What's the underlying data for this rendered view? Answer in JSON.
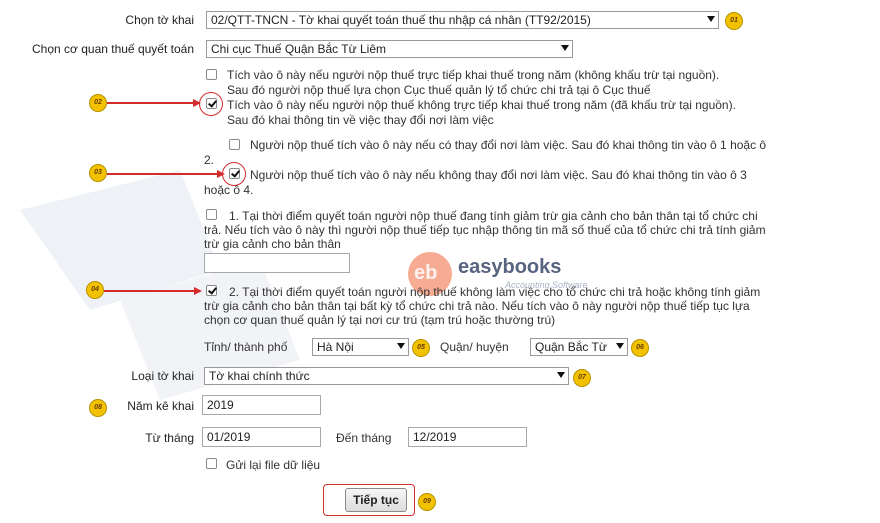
{
  "form": {
    "to_khai_label": "Chọn tờ khai",
    "to_khai_value": "02/QTT-TNCN - Tờ khai quyết toán thuế thu nhập cá nhân (TT92/2015)",
    "co_quan_label": "Chọn cơ quan thuế quyết toán",
    "co_quan_value": "Chi cục Thuế Quận Bắc Từ Liêm",
    "opt1_line1": "Tích vào ô này nếu người nộp thuế trực tiếp khai thuế trong năm (không khấu trừ tại nguồn).",
    "opt1_line2": "Sau đó người nộp thuế lựa chọn Cục thuế quản lý tổ chức chi trả tại ô Cục thuế",
    "opt2_line1": "Tích vào ô này nếu người nộp thuế không trực tiếp khai thuế trong năm (đã khấu trừ tại nguồn).",
    "opt2_line2": "Sau đó khai thông tin về việc thay đổi nơi làm việc",
    "sub1_line1": "Người nộp thuế tích vào ô này nếu có thay đổi nơi làm việc. Sau đó khai thông tin vào ô 1 hoặc ô",
    "sub1_line2": "2.",
    "sub2_line1": "Người nộp thuế tích vào ô này nếu không thay đổi nơi làm việc. Sau đó khai thông tin vào ô 3",
    "sub2_line2": "hoặc ô 4.",
    "c1_line1": "1. Tại thời điểm quyết toán người nộp thuế đang tính giảm trừ gia cảnh cho bản thân tại tổ chức chi",
    "c1_line2": "trả. Nếu tích vào ô này thì người nộp thuế tiếp tục nhập thông tin mã số thuế của tổ chức chi trả tính giảm",
    "c1_line3": "trừ gia cảnh cho bản thân",
    "c2_line1": "2. Tại thời điểm quyết toán người nộp thuế không làm việc cho tổ chức chi trả hoặc không tính giảm",
    "c2_line2": "trừ gia cảnh cho bản thân tại bất kỳ tổ chức chi trả nào. Nếu tích vào ô này người nộp thuế tiếp tục lựa",
    "c2_line3": "chọn cơ quan thuế quản lý tại nơi cư trú (tạm trú hoặc thường trú)",
    "tinh_label": "Tỉnh/ thành phố",
    "tinh_value": "Hà Nội",
    "quan_label": "Quận/ huyện",
    "quan_value": "Quận Bắc Từ",
    "loai_label": "Loại tờ khai",
    "loai_value": "Tờ khai chính thức",
    "nam_label": "Năm kê khai",
    "nam_value": "2019",
    "tu_thang_label": "Từ tháng",
    "tu_thang_value": "01/2019",
    "den_thang_label": "Đến tháng",
    "den_thang_value": "12/2019",
    "gui_lai_label": "Gửi lại file dữ liệu",
    "submit_label": "Tiếp tục"
  },
  "badges": [
    "01",
    "02",
    "03",
    "04",
    "05",
    "06",
    "07",
    "08",
    "09"
  ],
  "watermark": {
    "brand": "easybooks",
    "logo_text": "eb",
    "tagline": "Accounting Software"
  },
  "colors": {
    "annotation_red": "#d42b2b",
    "badge_yellow": "#f2c200",
    "logo_orange": "#f0663a"
  }
}
